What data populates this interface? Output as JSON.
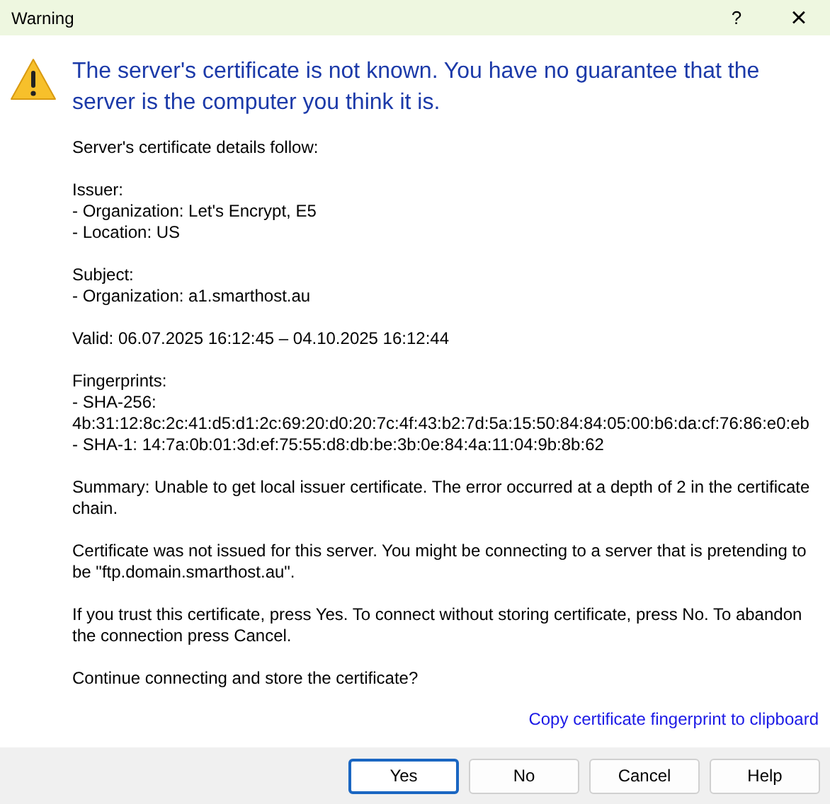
{
  "window": {
    "title": "Warning",
    "help": "?",
    "close": "×"
  },
  "heading": "The server's certificate is not known. You have no guarantee that the server is the computer you think it is.",
  "paragraphs": [
    {
      "lines": [
        "Server's certificate details follow:"
      ]
    },
    {
      "lines": [
        "Issuer:",
        "- Organization: Let's Encrypt, E5",
        "- Location: US"
      ]
    },
    {
      "lines": [
        "Subject:",
        "- Organization: a1.smarthost.au"
      ]
    },
    {
      "lines": [
        "Valid: 06.07.2025 16:12:45 – 04.10.2025 16:12:44"
      ]
    },
    {
      "lines": [
        "Fingerprints:",
        "- SHA-256:",
        "4b:31:12:8c:2c:41:d5:d1:2c:69:20:d0:20:7c:4f:43:b2:7d:5a:15:50:84:84:05:00:b6:da:cf:76:86:e0:eb",
        "- SHA-1: 14:7a:0b:01:3d:ef:75:55:d8:db:be:3b:0e:84:4a:11:04:9b:8b:62"
      ]
    },
    {
      "lines": [
        "Summary: Unable to get local issuer certificate. The error occurred at a depth of 2 in the certificate chain."
      ]
    },
    {
      "lines": [
        "Certificate was not issued for this server. You might be connecting to a server that is pretending to be \"ftp.domain.smarthost.au\"."
      ]
    },
    {
      "lines": [
        "If you trust this certificate, press Yes. To connect without storing certificate, press No. To abandon the connection press Cancel."
      ]
    },
    {
      "lines": [
        "Continue connecting and store the certificate?"
      ]
    }
  ],
  "link": "Copy certificate fingerprint to clipboard",
  "buttons": [
    {
      "label": "Yes",
      "default": true
    },
    {
      "label": "No",
      "default": false
    },
    {
      "label": "Cancel",
      "default": false
    },
    {
      "label": "Help",
      "default": false
    }
  ]
}
